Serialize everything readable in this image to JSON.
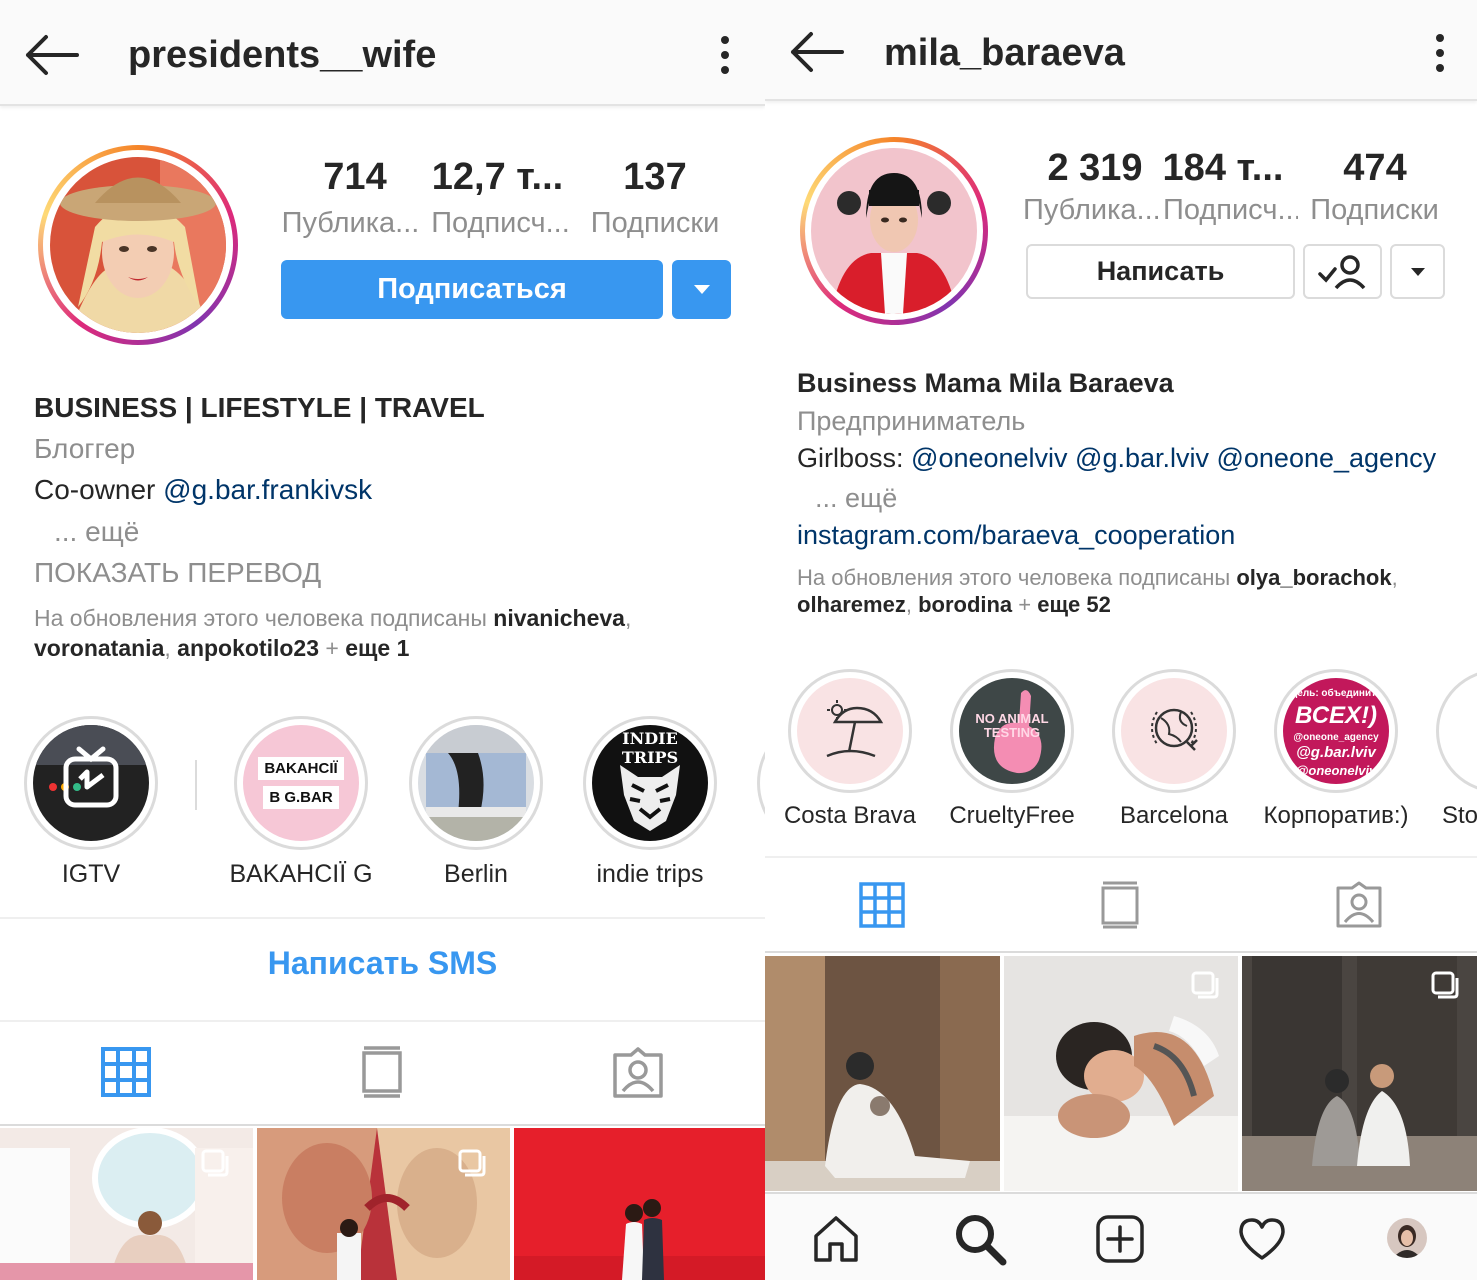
{
  "left": {
    "username": "presidents__wife",
    "stats": [
      {
        "value": "714",
        "label": "Публика..."
      },
      {
        "value": "12,7 т...",
        "label": "Подписч..."
      },
      {
        "value": "137",
        "label": "Подписки"
      }
    ],
    "follow_label": "Подписаться",
    "bio": {
      "name": "BUSINESS | LIFESTYLE | TRAVEL",
      "category": "Блоггер",
      "line_prefix": "Co-owner ",
      "line_link": "@g.bar.frankivsk",
      "more": "... ещё",
      "translate": "ПОКАЗАТЬ ПЕРЕВОД",
      "followed_prefix": "На обновления этого человека подписаны ",
      "followed_user1": "nivanicheva",
      "followed_sep1": ",",
      "followed_user2": "voronatania",
      "followed_sep2": ", ",
      "followed_user3": "anpokotilo23",
      "followed_plus": " + ",
      "followed_more": "еще 1"
    },
    "highlights": [
      {
        "label": "IGTV"
      },
      {
        "label": "BAKAHCIÏ G",
        "image_text1": "BAKAHCIÏ",
        "image_text2": "B G.BAR"
      },
      {
        "label": "Berlin"
      },
      {
        "label": "indie trips",
        "image_text": "INDIE TRIPS"
      }
    ],
    "sms_label": "Написать SMS"
  },
  "right": {
    "username": "mila_baraeva",
    "stats": [
      {
        "value": "2 319",
        "label": "Публика..."
      },
      {
        "value": "184 т...",
        "label": "Подписч..."
      },
      {
        "value": "474",
        "label": "Подписки"
      }
    ],
    "message_label": "Написать",
    "bio": {
      "name": "Business Mama Mila Baraeva",
      "category": "Предприниматель",
      "line_prefix": "Girlboss: ",
      "line_links": "@oneonelviv @g.bar.lviv @oneone_agency",
      "more": "... ещё",
      "website": "instagram.com/baraeva_cooperation",
      "followed_prefix": "На обновления этого человека подписаны ",
      "followed_user1": "olya_borachok",
      "followed_sep1": ",",
      "followed_user2": "olharemez",
      "followed_sep2": ", ",
      "followed_user3": "borodina",
      "followed_plus": " + ",
      "followed_more": "еще 52"
    },
    "highlights": [
      {
        "label": "Costa Brava"
      },
      {
        "label": "CrueltyFree",
        "image_text": "NO ANIMAL TESTING"
      },
      {
        "label": "Barcelona"
      },
      {
        "label": "Корпоратив:)",
        "image_text1": "Цель: объединить",
        "image_text2": "ВСЕХ!)",
        "image_text3": "@oneone_agency",
        "image_text4": "@g.bar.lviv",
        "image_text5": "@oneonelviv"
      },
      {
        "label": "Sto"
      }
    ]
  },
  "colors": {
    "accent_blue": "#3897f0",
    "link_blue": "#003569",
    "text": "#262626",
    "secondary": "#8e8e8e",
    "divider": "#efefef"
  },
  "icons": [
    "back-arrow-icon",
    "more-vertical-icon",
    "dropdown-icon",
    "grid-icon",
    "igtv-icon",
    "tagged-icon",
    "follow-check-icon",
    "home-icon",
    "search-icon",
    "add-icon",
    "heart-icon",
    "profile-avatar-icon",
    "multi-post-icon"
  ]
}
